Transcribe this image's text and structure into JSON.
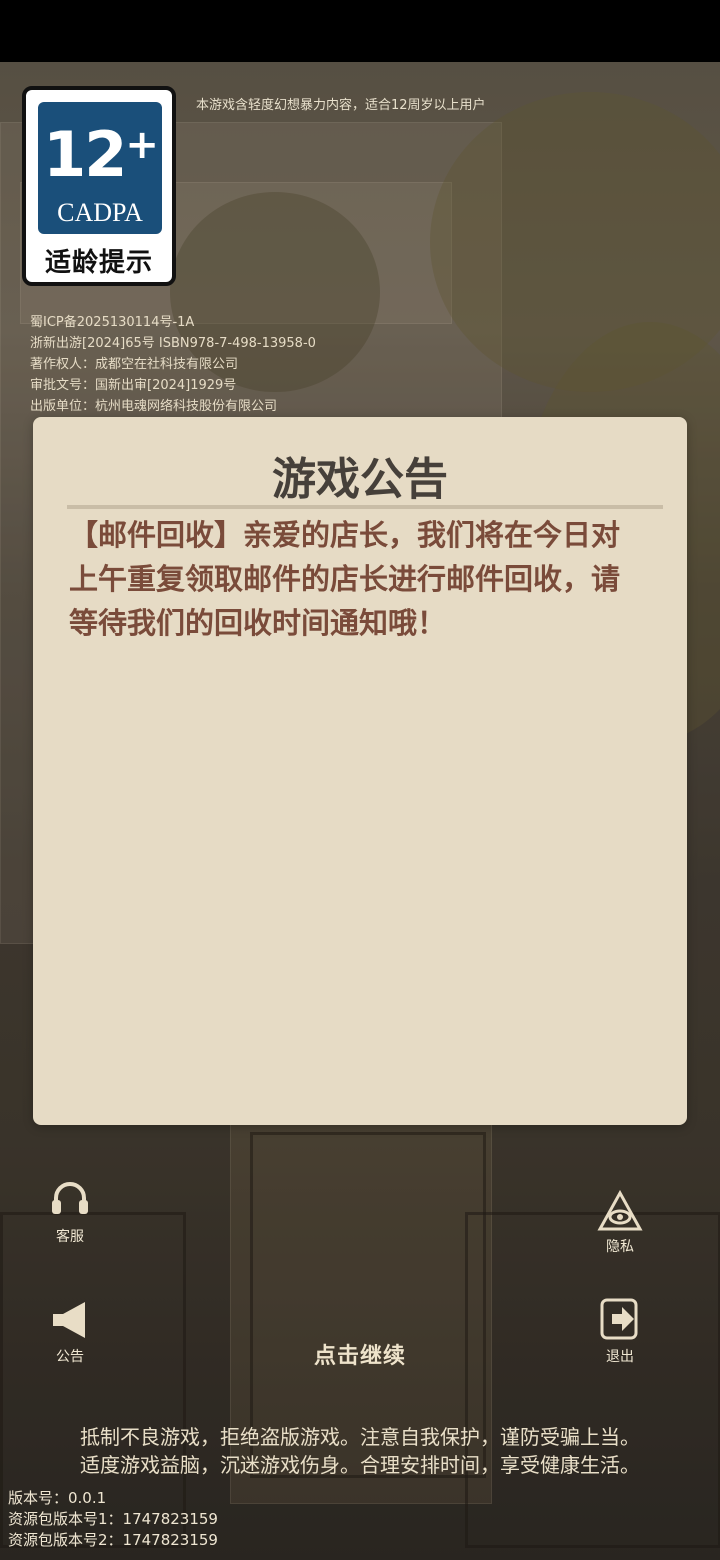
{
  "rating_note": "本游戏含轻度幻想暴力内容，适合12周岁以上用户",
  "age_badge": {
    "number": "12",
    "plus": "+",
    "org": "CADPA",
    "caption": "适龄提示"
  },
  "legal_lines": [
    "蜀ICP备2025130114号-1A",
    "浙新出游[2024]65号 ISBN978-7-498-13958-0",
    "著作权人：成都空在社科技有限公司",
    "审批文号：国新出审[2024]1929号",
    "出版单位：杭州电魂网络科技股份有限公司"
  ],
  "dialog": {
    "title": "游戏公告",
    "body": "【邮件回收】亲爱的店长，我们将在今日对上午重复领取邮件的店长进行邮件回收，请等待我们的回收时间通知哦！"
  },
  "buttons": {
    "service": {
      "label": "客服",
      "icon": "headset-icon"
    },
    "privacy": {
      "label": "隐私",
      "icon": "eye-triangle-icon"
    },
    "announcement": {
      "label": "公告",
      "icon": "megaphone-icon"
    },
    "exit": {
      "label": "退出",
      "icon": "exit-icon"
    }
  },
  "tap_continue": "点击继续",
  "health_notice": [
    "抵制不良游戏，拒绝盗版游戏。注意自我保护，谨防受骗上当。",
    "适度游戏益脑，沉迷游戏伤身。合理安排时间，享受健康生活。"
  ],
  "version": {
    "app": "版本号：0.0.1",
    "res1": "资源包版本号1：1747823159",
    "res2": "资源包版本号2：1747823159"
  }
}
